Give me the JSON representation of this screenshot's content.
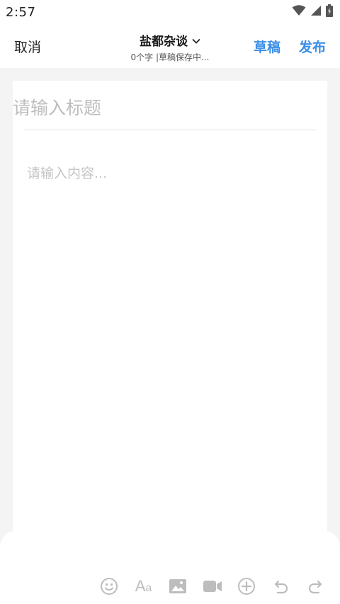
{
  "status_bar": {
    "time": "2:57"
  },
  "nav": {
    "cancel_label": "取消",
    "forum_name": "盐都杂谈",
    "subtitle": "0个字 |草稿保存中...",
    "draft_label": "草稿",
    "publish_label": "发布"
  },
  "editor": {
    "title_placeholder": "请输入标题",
    "content_placeholder": "请输入内容..."
  },
  "toolbar": {
    "text_style_glyph_big": "A",
    "text_style_glyph_small": "a",
    "icons": [
      "emoji-icon",
      "text-style-icon",
      "image-icon",
      "video-icon",
      "add-icon",
      "undo-icon",
      "redo-icon"
    ]
  },
  "colors": {
    "accent": "#3a8ee6",
    "icon_gray": "#bdbdbd",
    "background": "#f4f4f4"
  }
}
